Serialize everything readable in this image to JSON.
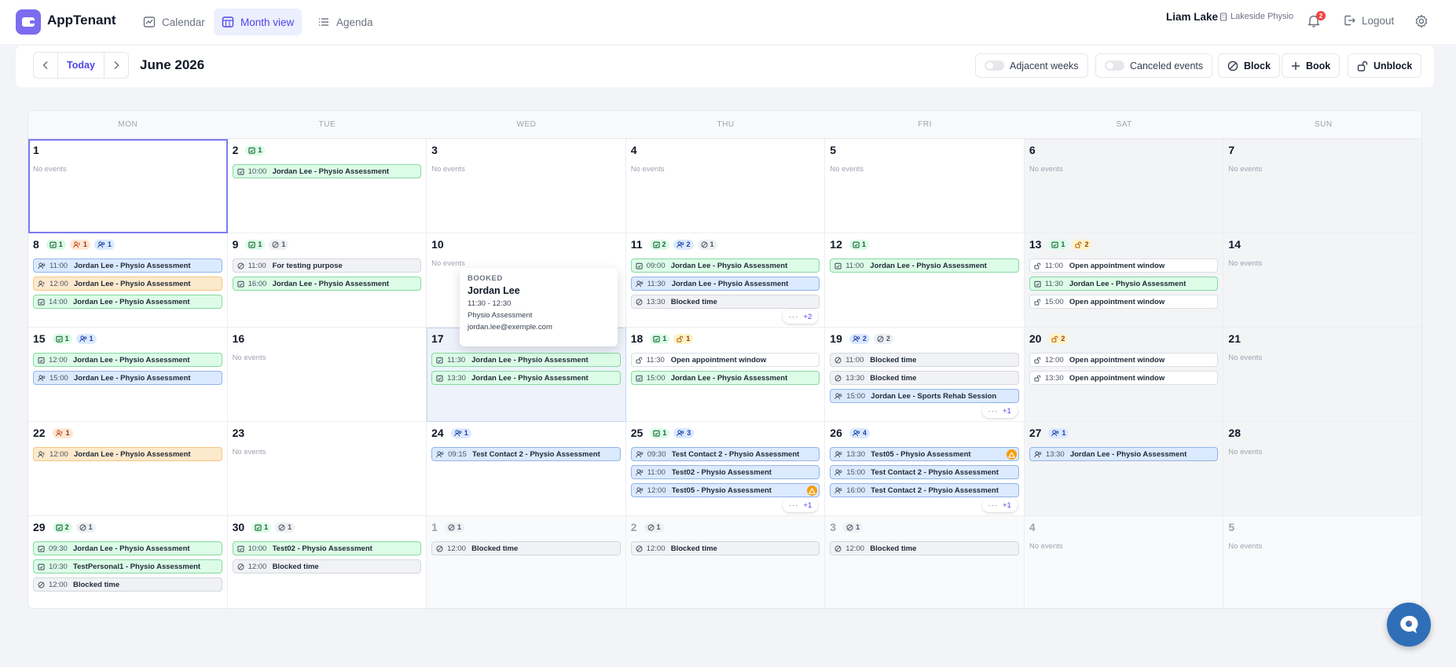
{
  "app": {
    "name": "AppTenant"
  },
  "nav": {
    "calendar": "Calendar",
    "month_view": "Month view",
    "agenda": "Agenda"
  },
  "user": {
    "name": "Liam Lake",
    "tenant": "Lakeside Physio",
    "notifications": "2",
    "logout": "Logout"
  },
  "toolbar": {
    "today": "Today",
    "month_title": "June 2026",
    "adjacent_weeks": "Adjacent weeks",
    "canceled_events": "Canceled events",
    "block": "Block",
    "book": "Book",
    "unblock": "Unblock"
  },
  "weekdays": [
    "MON",
    "TUE",
    "WED",
    "THU",
    "FRI",
    "SAT",
    "SUN"
  ],
  "no_events_text": "No events",
  "colors": {
    "accent": "#4f46e5",
    "booked": "#dcfce7",
    "contact": "#dbeafe",
    "pending": "#fde9cc",
    "blocked": "#f1f2f5",
    "warning": "#f59e0b",
    "chat": "#2f6fb8"
  },
  "weeks": [
    [
      {
        "day": "1",
        "selected": true,
        "chips": [],
        "events": []
      },
      {
        "day": "2",
        "chips": [
          {
            "type": "booked",
            "n": "1"
          }
        ],
        "events": [
          {
            "type": "booked",
            "time": "10:00",
            "title": "Jordan Lee - Physio Assessment"
          }
        ]
      },
      {
        "day": "3",
        "chips": [],
        "events": []
      },
      {
        "day": "4",
        "chips": [],
        "events": []
      },
      {
        "day": "5",
        "chips": [],
        "events": []
      },
      {
        "day": "6",
        "weekend": true,
        "chips": [],
        "events": []
      },
      {
        "day": "7",
        "weekend": true,
        "chips": [],
        "events": []
      }
    ],
    [
      {
        "day": "8",
        "chips": [
          {
            "type": "booked",
            "n": "1"
          },
          {
            "type": "pending",
            "n": "1"
          },
          {
            "type": "contact",
            "n": "1"
          }
        ],
        "events": [
          {
            "type": "contact",
            "time": "11:00",
            "title": "Jordan Lee - Physio Assessment"
          },
          {
            "type": "pending",
            "time": "12:00",
            "title": "Jordan Lee - Physio Assessment"
          },
          {
            "type": "booked",
            "time": "14:00",
            "title": "Jordan Lee - Physio Assessment"
          }
        ]
      },
      {
        "day": "9",
        "chips": [
          {
            "type": "booked",
            "n": "1"
          },
          {
            "type": "blocked",
            "n": "1"
          }
        ],
        "events": [
          {
            "type": "blocked",
            "time": "11:00",
            "title": "For testing purpose"
          },
          {
            "type": "booked",
            "time": "16:00",
            "title": "Jordan Lee - Physio Assessment"
          }
        ]
      },
      {
        "day": "10",
        "chips": [],
        "events": []
      },
      {
        "day": "11",
        "chips": [
          {
            "type": "booked",
            "n": "2"
          },
          {
            "type": "contact",
            "n": "2"
          },
          {
            "type": "blocked",
            "n": "1"
          }
        ],
        "events": [
          {
            "type": "booked",
            "time": "09:00",
            "title": "Jordan Lee - Physio Assessment"
          },
          {
            "type": "contact",
            "time": "11:30",
            "title": "Jordan Lee - Physio Assessment"
          },
          {
            "type": "blocked",
            "time": "13:30",
            "title": "Blocked time"
          }
        ],
        "more": "+2"
      },
      {
        "day": "12",
        "chips": [
          {
            "type": "booked",
            "n": "1"
          }
        ],
        "events": [
          {
            "type": "booked",
            "time": "11:00",
            "title": "Jordan Lee - Physio Assessment"
          }
        ]
      },
      {
        "day": "13",
        "weekend": true,
        "chips": [
          {
            "type": "booked",
            "n": "1"
          },
          {
            "type": "open",
            "n": "2"
          }
        ],
        "events": [
          {
            "type": "open",
            "time": "11:00",
            "title": "Open appointment window"
          },
          {
            "type": "booked",
            "time": "11:30",
            "title": "Jordan Lee - Physio Assessment"
          },
          {
            "type": "open",
            "time": "15:00",
            "title": "Open appointment window"
          }
        ]
      },
      {
        "day": "14",
        "weekend": true,
        "chips": [],
        "events": []
      }
    ],
    [
      {
        "day": "15",
        "chips": [
          {
            "type": "booked",
            "n": "1"
          },
          {
            "type": "contact",
            "n": "1"
          }
        ],
        "events": [
          {
            "type": "booked",
            "time": "12:00",
            "title": "Jordan Lee - Physio Assessment"
          },
          {
            "type": "contact",
            "time": "15:00",
            "title": "Jordan Lee - Physio Assessment"
          }
        ]
      },
      {
        "day": "16",
        "chips": [],
        "events": []
      },
      {
        "day": "17",
        "hilite": true,
        "chips": [],
        "events": [
          {
            "type": "booked",
            "time": "11:30",
            "title": "Jordan Lee - Physio Assessment"
          },
          {
            "type": "booked",
            "time": "13:30",
            "title": "Jordan Lee - Physio Assessment"
          }
        ]
      },
      {
        "day": "18",
        "chips": [
          {
            "type": "booked",
            "n": "1"
          },
          {
            "type": "open",
            "n": "1"
          }
        ],
        "events": [
          {
            "type": "open",
            "time": "11:30",
            "title": "Open appointment window"
          },
          {
            "type": "booked",
            "time": "15:00",
            "title": "Jordan Lee - Physio Assessment"
          }
        ]
      },
      {
        "day": "19",
        "chips": [
          {
            "type": "contact",
            "n": "2"
          },
          {
            "type": "blocked",
            "n": "2"
          }
        ],
        "events": [
          {
            "type": "blocked",
            "time": "11:00",
            "title": "Blocked time"
          },
          {
            "type": "blocked",
            "time": "13:30",
            "title": "Blocked time"
          },
          {
            "type": "contact",
            "time": "15:00",
            "title": "Jordan Lee - Sports Rehab Session"
          }
        ],
        "more": "+1"
      },
      {
        "day": "20",
        "weekend": true,
        "chips": [
          {
            "type": "open",
            "n": "2"
          }
        ],
        "events": [
          {
            "type": "open",
            "time": "12:00",
            "title": "Open appointment window"
          },
          {
            "type": "open",
            "time": "13:30",
            "title": "Open appointment window"
          }
        ]
      },
      {
        "day": "21",
        "weekend": true,
        "chips": [],
        "events": []
      }
    ],
    [
      {
        "day": "22",
        "chips": [
          {
            "type": "pending",
            "n": "1"
          }
        ],
        "events": [
          {
            "type": "pending",
            "time": "12:00",
            "title": "Jordan Lee - Physio Assessment"
          }
        ]
      },
      {
        "day": "23",
        "chips": [],
        "events": []
      },
      {
        "day": "24",
        "chips": [
          {
            "type": "contact",
            "n": "1"
          }
        ],
        "events": [
          {
            "type": "contact",
            "time": "09:15",
            "title": "Test Contact 2 - Physio Assessment"
          }
        ]
      },
      {
        "day": "25",
        "chips": [
          {
            "type": "booked",
            "n": "1"
          },
          {
            "type": "contact",
            "n": "3"
          }
        ],
        "events": [
          {
            "type": "contact",
            "time": "09:30",
            "title": "Test Contact 2 - Physio Assessment"
          },
          {
            "type": "contact",
            "time": "11:00",
            "title": "Test02 - Physio Assessment"
          },
          {
            "type": "contact",
            "time": "12:00",
            "title": "Test05 - Physio Assessment",
            "warn": true
          }
        ],
        "more": "+1"
      },
      {
        "day": "26",
        "chips": [
          {
            "type": "contact",
            "n": "4"
          }
        ],
        "events": [
          {
            "type": "contact",
            "time": "13:30",
            "title": "Test05 - Physio Assessment",
            "warn": true
          },
          {
            "type": "contact",
            "time": "15:00",
            "title": "Test Contact 2 - Physio Assessment"
          },
          {
            "type": "contact",
            "time": "16:00",
            "title": "Test Contact 2 - Physio Assessment"
          }
        ],
        "more": "+1"
      },
      {
        "day": "27",
        "weekend": true,
        "chips": [
          {
            "type": "contact",
            "n": "1"
          }
        ],
        "events": [
          {
            "type": "contact",
            "time": "13:30",
            "title": "Jordan Lee - Physio Assessment"
          }
        ]
      },
      {
        "day": "28",
        "weekend": true,
        "chips": [],
        "events": []
      }
    ],
    [
      {
        "day": "29",
        "chips": [
          {
            "type": "booked",
            "n": "2"
          },
          {
            "type": "blocked",
            "n": "1"
          }
        ],
        "events": [
          {
            "type": "booked",
            "time": "09:30",
            "title": "Jordan Lee - Physio Assessment"
          },
          {
            "type": "booked",
            "time": "10:30",
            "title": "TestPersonal1 - Physio Assessment"
          },
          {
            "type": "blocked",
            "time": "12:00",
            "title": "Blocked time"
          }
        ]
      },
      {
        "day": "30",
        "chips": [
          {
            "type": "booked",
            "n": "1"
          },
          {
            "type": "blocked",
            "n": "1"
          }
        ],
        "events": [
          {
            "type": "booked",
            "time": "10:00",
            "title": "Test02 - Physio Assessment"
          },
          {
            "type": "blocked",
            "time": "12:00",
            "title": "Blocked time"
          }
        ]
      },
      {
        "day": "1",
        "other": true,
        "chips": [
          {
            "type": "blocked",
            "n": "1"
          }
        ],
        "events": [
          {
            "type": "blocked",
            "time": "12:00",
            "title": "Blocked time"
          }
        ]
      },
      {
        "day": "2",
        "other": true,
        "chips": [
          {
            "type": "blocked",
            "n": "1"
          }
        ],
        "events": [
          {
            "type": "blocked",
            "time": "12:00",
            "title": "Blocked time"
          }
        ]
      },
      {
        "day": "3",
        "other": true,
        "chips": [
          {
            "type": "blocked",
            "n": "1"
          }
        ],
        "events": [
          {
            "type": "blocked",
            "time": "12:00",
            "title": "Blocked time"
          }
        ]
      },
      {
        "day": "4",
        "other": true,
        "weekend": true,
        "chips": [],
        "events": []
      },
      {
        "day": "5",
        "other": true,
        "weekend": true,
        "chips": [],
        "events": []
      }
    ]
  ],
  "popover": {
    "label": "BOOKED",
    "name": "Jordan Lee",
    "time": "11:30 - 12:30",
    "type": "Physio Assessment",
    "email": "jordan.lee@exemple.com"
  }
}
